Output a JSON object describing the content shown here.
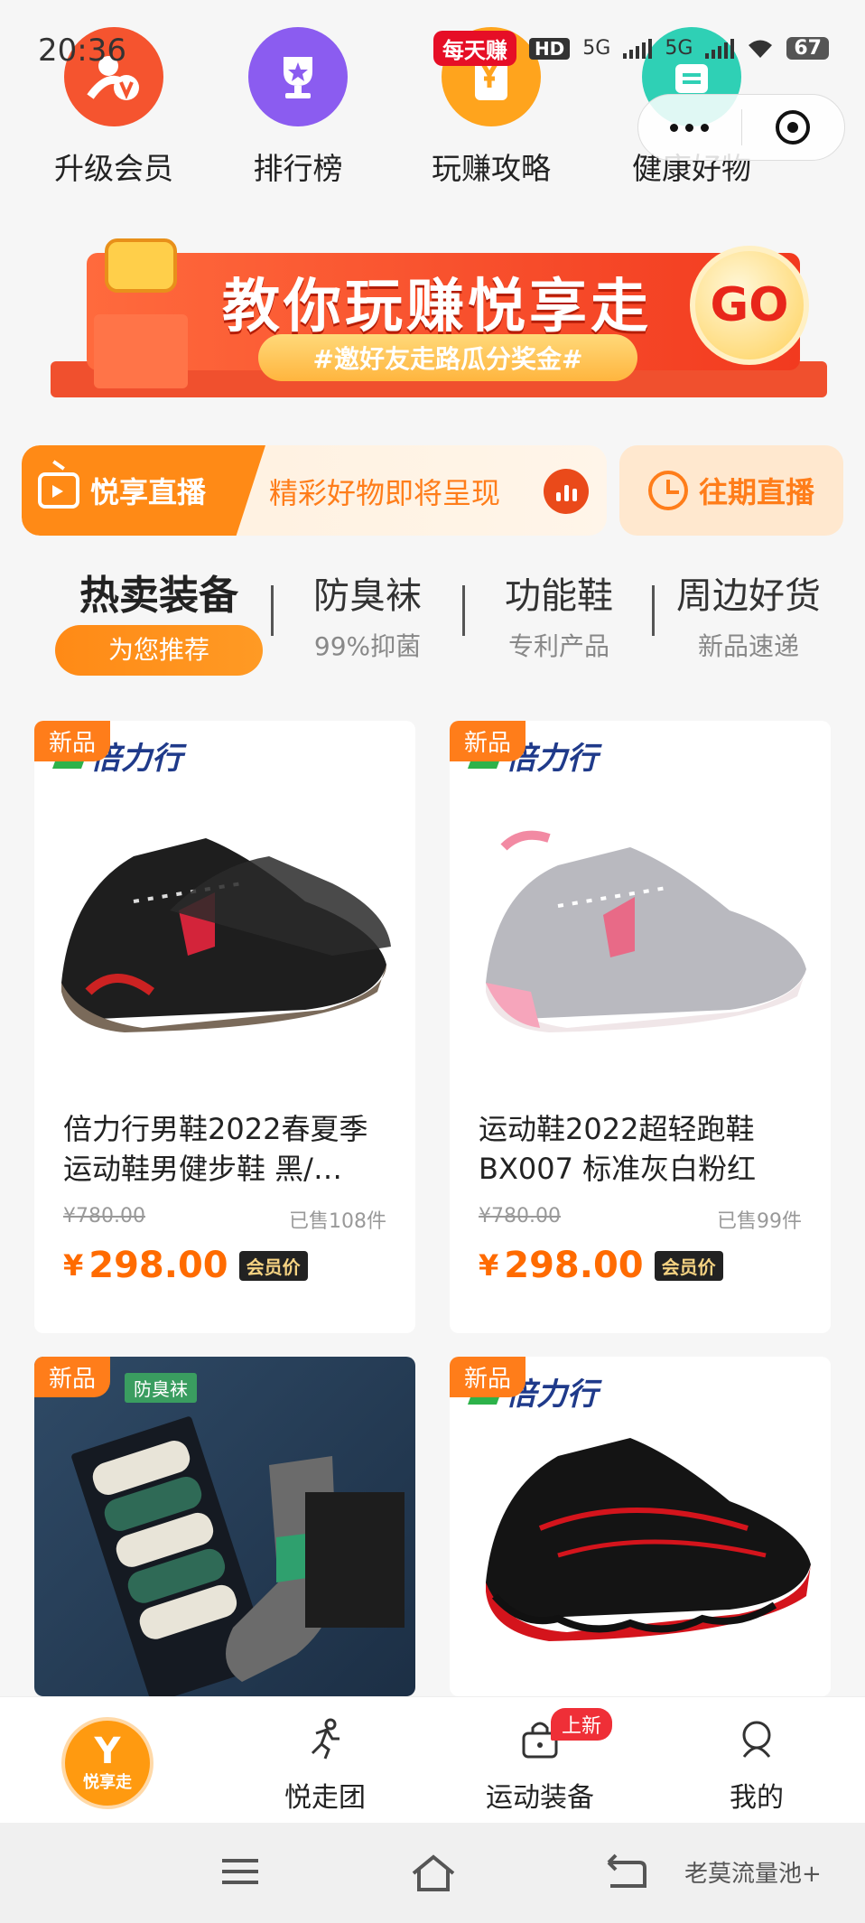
{
  "status_bar": {
    "time": "20:36",
    "app_badge": "每天赚",
    "hd": "HD",
    "net1": "5G",
    "net2": "5G",
    "battery": "67"
  },
  "quick_icons": [
    {
      "label": "升级会员",
      "icon": "member-upgrade-icon",
      "color": "#f5542f"
    },
    {
      "label": "排行榜",
      "icon": "trophy-icon",
      "color": "#8b5cf0"
    },
    {
      "label": "玩赚攻略",
      "icon": "guide-icon",
      "color": "#ffa41d"
    },
    {
      "label": "健康好物",
      "icon": "health-goods-icon",
      "color": "#2fd0b5"
    }
  ],
  "banner": {
    "title": "教你玩赚悦享走",
    "subtitle": "#邀好友走路瓜分奖金#",
    "go_label": "GO"
  },
  "live": {
    "tag_label": "悦享直播",
    "promo_text": "精彩好物即将呈现",
    "past_label": "往期直播"
  },
  "tabs": [
    {
      "title": "热卖装备",
      "sub": "为您推荐",
      "active": true
    },
    {
      "title": "防臭袜",
      "sub": "99%抑菌"
    },
    {
      "title": "功能鞋",
      "sub": "专利产品"
    },
    {
      "title": "周边好货",
      "sub": "新品速递"
    }
  ],
  "products": [
    {
      "tag": "新品",
      "brand": "倍力行",
      "title": "倍力行男鞋2022春夏季运动鞋男健步鞋 黑/…",
      "orig_price": "¥780.00",
      "sold": "已售108件",
      "price_symbol": "¥",
      "price": "298.00",
      "member_label": "会员价"
    },
    {
      "tag": "新品",
      "brand": "倍力行",
      "title": "运动鞋2022超轻跑鞋BX007 标准灰白粉红",
      "orig_price": "¥780.00",
      "sold": "已售99件",
      "price_symbol": "¥",
      "price": "298.00",
      "member_label": "会员价"
    },
    {
      "tag": "新品",
      "badge": "防臭袜"
    },
    {
      "tag": "新品",
      "brand": "倍力行"
    }
  ],
  "bottom_nav": [
    {
      "label": "",
      "logo_text": "悦享走"
    },
    {
      "label": "悦走团",
      "icon": "runner-icon"
    },
    {
      "label": "运动装备",
      "icon": "bag-icon",
      "badge": "上新"
    },
    {
      "label": "我的",
      "icon": "profile-icon"
    }
  ],
  "watermark": "老莫流量池+"
}
